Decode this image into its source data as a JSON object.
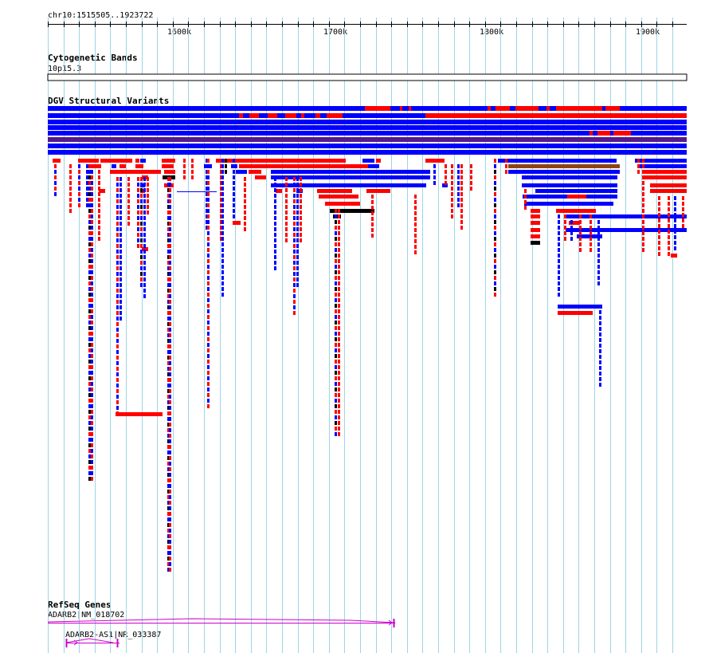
{
  "colors": {
    "background": "#ffffff",
    "grid": "#9fd4e6",
    "ruler": "#000000",
    "gain": "#0000ff",
    "loss": "#ff0000",
    "complex": "#000000",
    "other": "#8b4513",
    "inversion": "#551a8b",
    "gene": "#cc00cc"
  },
  "region_label": "chr10:1515505..1923722",
  "ruler": {
    "ticks": [
      "1600k",
      "1700k",
      "1800k",
      "1900k"
    ]
  },
  "tracks": {
    "cytoband": {
      "title": "Cytogenetic Bands",
      "band_label": "10p15.3"
    },
    "dgv": {
      "title": "DGV Structural Variants",
      "legend_types": [
        "gain",
        "loss",
        "complex",
        "other",
        "inversion"
      ]
    },
    "refseq": {
      "title": "RefSeq Genes",
      "genes": [
        {
          "label": "ADARB2|NM_018702",
          "strand": "-"
        },
        {
          "label": "ADARB2-AS1|NR_033387",
          "strand": "+"
        }
      ]
    }
  }
}
